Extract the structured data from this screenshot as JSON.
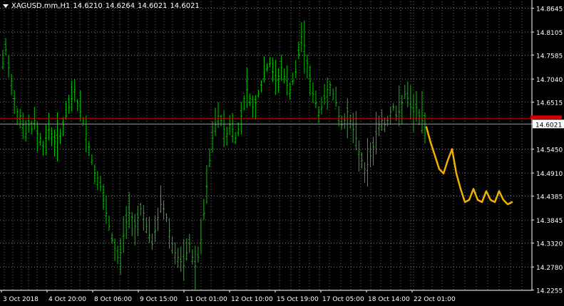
{
  "header": {
    "symbol": "XAGUSD.mm,H1",
    "open": "14.6210",
    "high": "14.6264",
    "low": "14.6021",
    "close": "14.6021"
  },
  "colors": {
    "background": "#000000",
    "grid": "#ffffff",
    "candles": "#00c800",
    "price_line": "#d00000",
    "current_price_line": "#9a9a9a",
    "drawing": "#f0b000",
    "axis_text": "#ffffff",
    "price_label_bg": "#ffffff",
    "price_label_fg": "#000000",
    "red_label_bg": "#d00000"
  },
  "chart_data": {
    "type": "line",
    "ylim": [
      14.225,
      14.88
    ],
    "ytick_labels": [
      "14.8645",
      "14.8105",
      "14.7585",
      "14.7040",
      "14.6515",
      "14.6021",
      "14.5450",
      "14.4910",
      "14.4385",
      "14.3845",
      "14.3320",
      "14.2780",
      "14.2255"
    ],
    "x_tick_labels": [
      "3 Oct 2018",
      "4 Oct 20:00",
      "8 Oct 06:00",
      "9 Oct 15:00",
      "11 Oct 01:00",
      "12 Oct 10:00",
      "15 Oct 19:00",
      "17 Oct 05:00",
      "18 Oct 14:00",
      "22 Oct 01:00"
    ],
    "current_price": 14.6021,
    "red_level": 14.615,
    "series": [
      {
        "values": [
          14.74,
          14.77,
          14.73,
          14.7,
          14.66,
          14.63,
          14.62,
          14.6,
          14.58,
          14.6,
          14.59,
          14.61,
          14.58,
          14.57,
          14.55,
          14.57,
          14.59,
          14.58,
          14.56,
          14.57,
          14.58,
          14.6,
          14.62,
          14.64,
          14.66,
          14.68,
          14.65,
          14.63,
          14.61,
          14.58,
          14.55,
          14.52,
          14.49,
          14.48,
          14.46,
          14.43,
          14.4,
          14.37,
          14.34,
          14.32,
          14.3,
          14.31,
          14.35,
          14.38,
          14.4,
          14.39,
          14.37,
          14.39,
          14.41,
          14.4,
          14.37,
          14.35,
          14.33,
          14.36,
          14.39,
          14.42,
          14.41,
          14.39,
          14.36,
          14.33,
          14.31,
          14.3,
          14.29,
          14.28,
          14.31,
          14.33,
          14.3,
          14.28,
          14.3,
          14.34,
          14.4,
          14.46,
          14.52,
          14.57,
          14.6,
          14.62,
          14.61,
          14.59,
          14.58,
          14.6,
          14.59,
          14.57,
          14.59,
          14.62,
          14.66,
          14.68,
          14.66,
          14.64,
          14.65,
          14.67,
          14.69,
          14.71,
          14.73,
          14.74,
          14.72,
          14.7,
          14.71,
          14.73,
          14.71,
          14.69,
          14.68,
          14.7,
          14.72,
          14.76,
          14.8,
          14.78,
          14.74,
          14.7,
          14.67,
          14.65,
          14.63,
          14.64,
          14.66,
          14.68,
          14.69,
          14.67,
          14.65,
          14.62,
          14.6,
          14.61,
          14.63,
          14.61,
          14.59,
          14.57,
          14.54,
          14.52,
          14.5,
          14.51,
          14.53,
          14.55,
          14.58,
          14.6,
          14.61,
          14.6,
          14.61,
          14.63,
          14.64,
          14.62,
          14.63,
          14.65,
          14.67,
          14.66,
          14.64,
          14.63,
          14.64,
          14.62,
          14.61,
          14.6021
        ],
        "style": "bars"
      }
    ],
    "drawing_path": [
      [
        14.595
      ],
      [
        14.56
      ],
      [
        14.53
      ],
      [
        14.5
      ],
      [
        14.49
      ],
      [
        14.52
      ],
      [
        14.545
      ],
      [
        14.49
      ],
      [
        14.455
      ],
      [
        14.425
      ],
      [
        14.43
      ],
      [
        14.455
      ],
      [
        14.43
      ],
      [
        14.425
      ],
      [
        14.45
      ],
      [
        14.43
      ],
      [
        14.425
      ],
      [
        14.45
      ],
      [
        14.43
      ],
      [
        14.42
      ],
      [
        14.425
      ]
    ]
  }
}
